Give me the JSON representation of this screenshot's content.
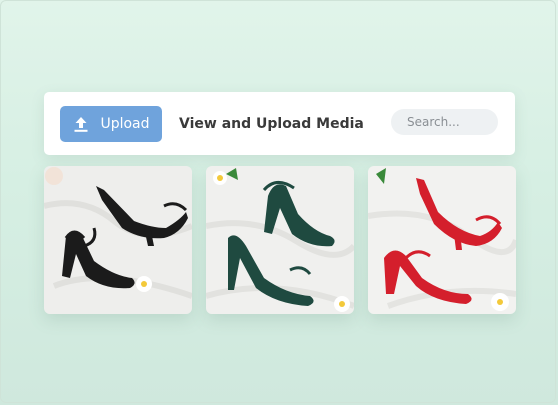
{
  "toolbar": {
    "upload_label": "Upload",
    "title": "View and Upload Media",
    "search_placeholder": "Search..."
  },
  "media": [
    {
      "name": "black-strappy-sandals",
      "color": "#1b1b1b"
    },
    {
      "name": "green-strappy-sandals",
      "color": "#1f4a40"
    },
    {
      "name": "red-strappy-sandals",
      "color": "#d41f2c"
    }
  ],
  "colors": {
    "accent": "#6fa3dc",
    "background": "#d8efe4"
  }
}
